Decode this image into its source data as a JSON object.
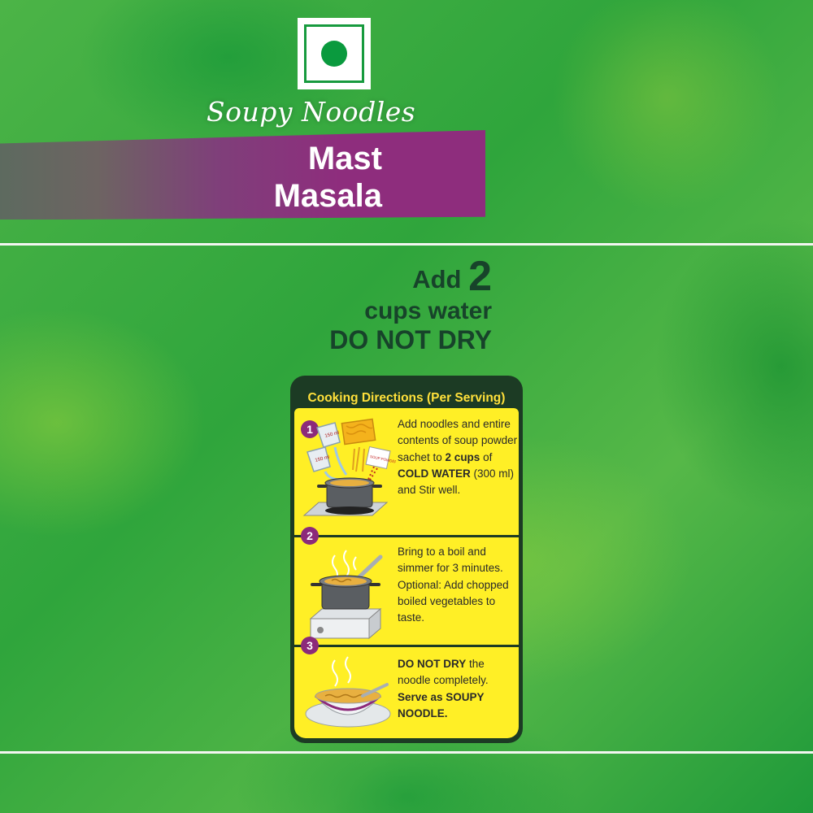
{
  "brand": {
    "product_line": "Soupy Noodles",
    "variant_line1": "Mast",
    "variant_line2": "Masala"
  },
  "instruction": {
    "add_word": "Add",
    "number": "2",
    "cups_text": "cups water",
    "warning": "DO NOT DRY"
  },
  "directions": {
    "title": "Cooking Directions (Per Serving)",
    "steps": [
      {
        "number": "1",
        "parts": [
          "Add noodles and entire contents of soup powder sachet to ",
          "2 cups",
          " of ",
          "COLD WATER",
          " (300 ml) and Stir well."
        ],
        "cup_label": "150 ml",
        "sachet_label": "SOUP POWDER"
      },
      {
        "number": "2",
        "text": "Bring to a boil and simmer for 3 minutes. Optional: Add chopped boiled vegetables to taste."
      },
      {
        "number": "3",
        "parts": [
          "DO NOT DRY",
          " the noodle completely. ",
          "Serve as SOUPY NOODLE."
        ]
      }
    ]
  },
  "colors": {
    "background_green": "#3aaa42",
    "banner_purple": "#8e2d7d",
    "card_dark": "#1c3b24",
    "panel_yellow": "#ffef26",
    "title_yellow": "#ffe03a",
    "heading_dark_green": "#17432a"
  },
  "icons": [
    "veg-mark-icon",
    "cooking-pot-icon",
    "water-cup-icon",
    "noodle-block-icon",
    "soup-sachet-icon",
    "stove-icon",
    "ladle-icon",
    "soup-bowl-icon"
  ]
}
